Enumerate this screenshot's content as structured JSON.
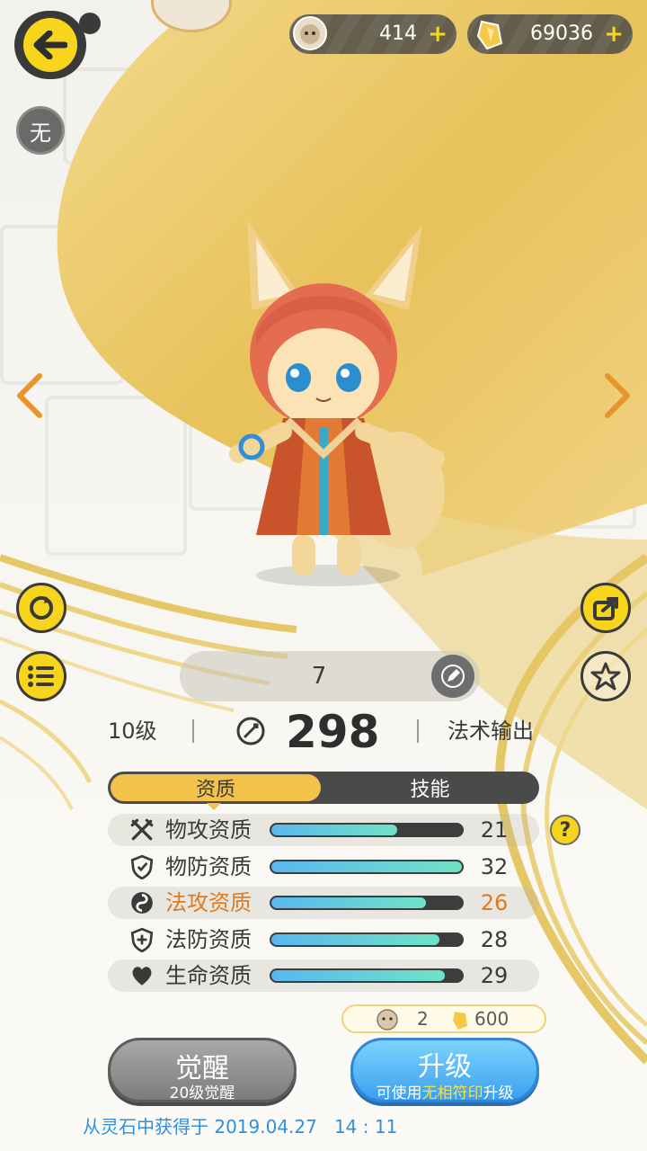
{
  "currency": {
    "pets": "414",
    "gems": "69036"
  },
  "top_icons": {
    "mode_badge": "无"
  },
  "card": {
    "name": "7",
    "level": "10级",
    "power": "298",
    "role": "法术输出"
  },
  "tabs": [
    {
      "label": "资质",
      "active": true
    },
    {
      "label": "技能",
      "active": false
    }
  ],
  "stats": [
    {
      "label": "物攻资质",
      "value": "21",
      "fill": 0.66,
      "icon": "swords-icon",
      "highlight": false
    },
    {
      "label": "物防资质",
      "value": "32",
      "fill": 1.0,
      "icon": "shield-icon",
      "highlight": false
    },
    {
      "label": "法攻资质",
      "value": "26",
      "fill": 0.81,
      "icon": "swirl-icon",
      "highlight": true
    },
    {
      "label": "法防资质",
      "value": "28",
      "fill": 0.88,
      "icon": "magic-shield-icon",
      "highlight": false
    },
    {
      "label": "生命资质",
      "value": "29",
      "fill": 0.91,
      "icon": "heart-icon",
      "highlight": false
    }
  ],
  "cost": {
    "pets": "2",
    "gems": "600"
  },
  "buttons": {
    "awaken_title": "觉醒",
    "awaken_sub": "20级觉醒",
    "upgrade_title": "升级",
    "upgrade_sub_pre": "可使用",
    "upgrade_sub_highlight": "无相符印",
    "upgrade_sub_post": "升级"
  },
  "footer": "从灵石中获得于 2019.04.27   14 : 11",
  "colors": {
    "accent": "#f7d51c",
    "gold": "#e8c25a",
    "highlight_text": "#e07a1f",
    "bar_start": "#58b8f0",
    "bar_end": "#6fe3c6"
  }
}
